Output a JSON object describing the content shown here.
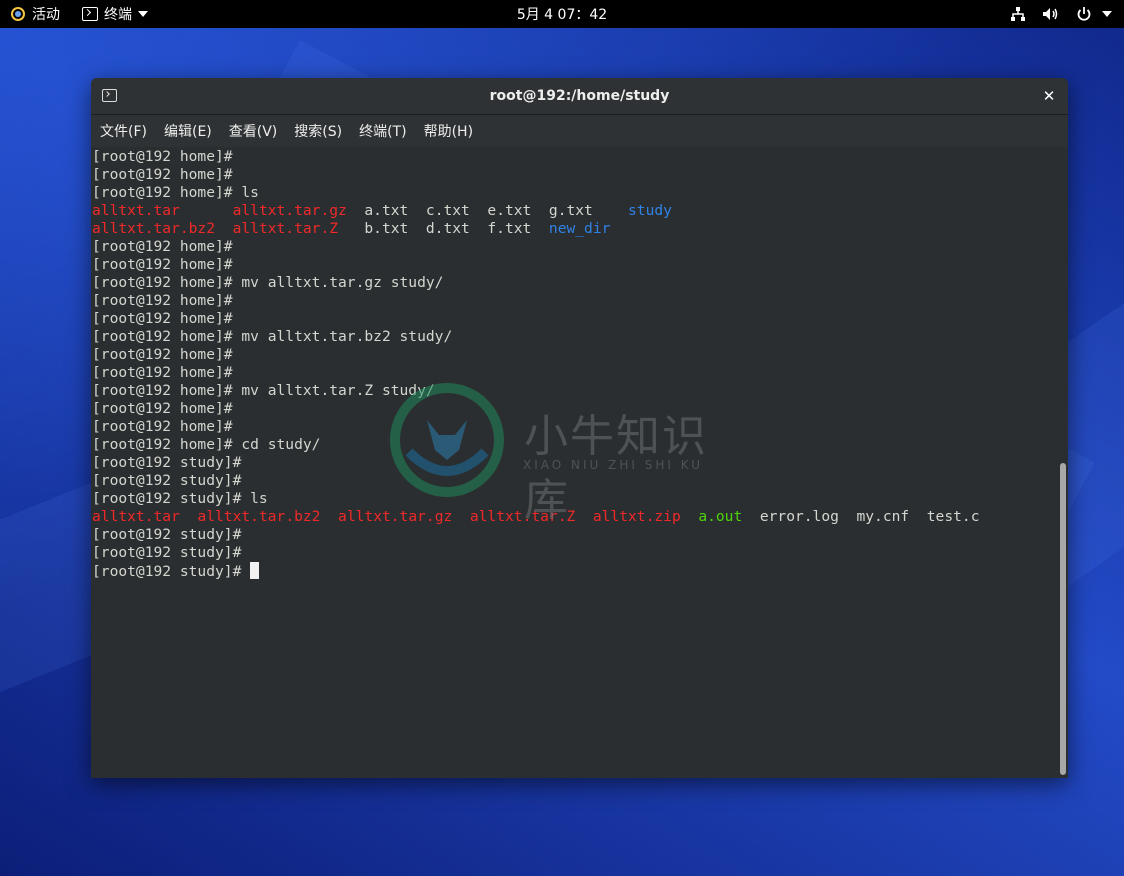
{
  "topbar": {
    "activities_label": "活动",
    "app_menu_label": "终端",
    "clock": "5月 4  07：42",
    "icons": [
      "network-icon",
      "volume-icon",
      "power-icon",
      "chevron-down-icon"
    ]
  },
  "window": {
    "title": "root@192:/home/study",
    "close_glyph": "✕",
    "menu": [
      "文件(F)",
      "编辑(E)",
      "查看(V)",
      "搜索(S)",
      "终端(T)",
      "帮助(H)"
    ]
  },
  "watermark": {
    "text": "小牛知识库",
    "subtext": "XIAO NIU ZHI SHI KU"
  },
  "terminal": {
    "colors": {
      "archive": "#ef2929",
      "directory": "#2f83e6",
      "executable": "#4ed40a",
      "plain": "#d3d7cf"
    },
    "lines": [
      [
        {
          "t": "[root@192 home]#"
        }
      ],
      [
        {
          "t": "[root@192 home]#"
        }
      ],
      [
        {
          "t": "[root@192 home]# ls"
        }
      ],
      [
        {
          "t": "alltxt.tar",
          "c": "red"
        },
        {
          "t": "      "
        },
        {
          "t": "alltxt.tar.gz",
          "c": "red"
        },
        {
          "t": "  a.txt  c.txt  e.txt  g.txt    "
        },
        {
          "t": "study",
          "c": "blue"
        }
      ],
      [
        {
          "t": "alltxt.tar.bz2",
          "c": "red"
        },
        {
          "t": "  "
        },
        {
          "t": "alltxt.tar.Z",
          "c": "red"
        },
        {
          "t": "   b.txt  d.txt  f.txt  "
        },
        {
          "t": "new_dir",
          "c": "blue"
        }
      ],
      [
        {
          "t": "[root@192 home]#"
        }
      ],
      [
        {
          "t": "[root@192 home]#"
        }
      ],
      [
        {
          "t": "[root@192 home]# mv alltxt.tar.gz study/"
        }
      ],
      [
        {
          "t": "[root@192 home]#"
        }
      ],
      [
        {
          "t": "[root@192 home]#"
        }
      ],
      [
        {
          "t": "[root@192 home]# mv alltxt.tar.bz2 study/"
        }
      ],
      [
        {
          "t": "[root@192 home]#"
        }
      ],
      [
        {
          "t": "[root@192 home]#"
        }
      ],
      [
        {
          "t": "[root@192 home]# mv alltxt.tar.Z study/"
        }
      ],
      [
        {
          "t": "[root@192 home]#"
        }
      ],
      [
        {
          "t": "[root@192 home]#"
        }
      ],
      [
        {
          "t": "[root@192 home]# cd study/"
        }
      ],
      [
        {
          "t": "[root@192 study]#"
        }
      ],
      [
        {
          "t": "[root@192 study]#"
        }
      ],
      [
        {
          "t": "[root@192 study]# ls"
        }
      ],
      [
        {
          "t": "alltxt.tar",
          "c": "red"
        },
        {
          "t": "  "
        },
        {
          "t": "alltxt.tar.bz2",
          "c": "red"
        },
        {
          "t": "  "
        },
        {
          "t": "alltxt.tar.gz",
          "c": "red"
        },
        {
          "t": "  "
        },
        {
          "t": "alltxt.tar.Z",
          "c": "red"
        },
        {
          "t": "  "
        },
        {
          "t": "alltxt.zip",
          "c": "red"
        },
        {
          "t": "  "
        },
        {
          "t": "a.out",
          "c": "green"
        },
        {
          "t": "  error.log  my.cnf  test.c"
        }
      ],
      [
        {
          "t": "[root@192 study]#"
        }
      ],
      [
        {
          "t": "[root@192 study]#"
        }
      ],
      [
        {
          "t": "[root@192 study]# "
        },
        {
          "cursor": true
        }
      ]
    ]
  }
}
